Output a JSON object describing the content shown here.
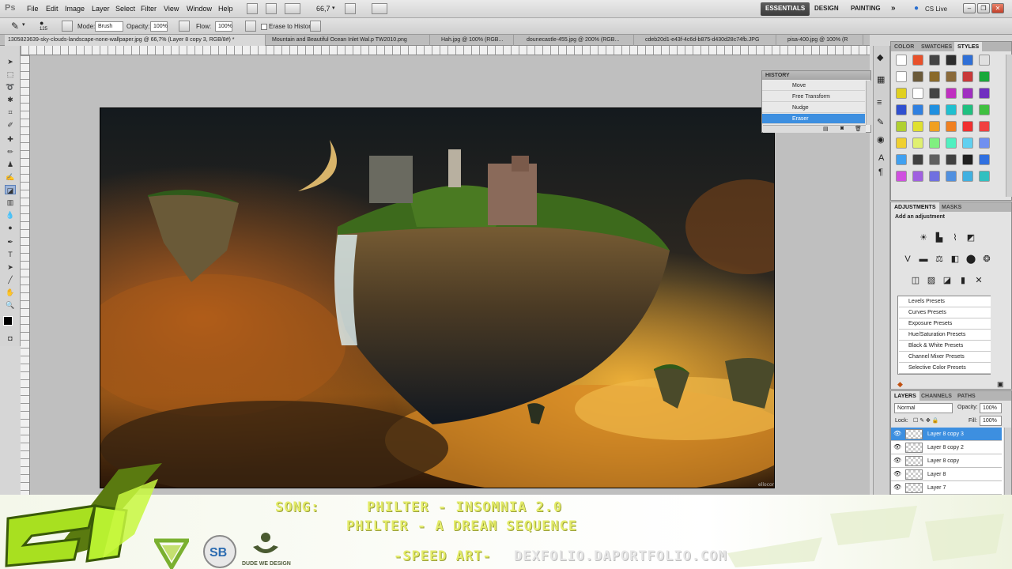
{
  "app": {
    "logo": "Ps"
  },
  "menubar": {
    "items": [
      "File",
      "Edit",
      "Image",
      "Layer",
      "Select",
      "Filter",
      "View",
      "Window",
      "Help"
    ],
    "zoom": "66,7",
    "workspaces": [
      "ESSENTIALS",
      "DESIGN",
      "PAINTING"
    ],
    "cs_live": "CS Live"
  },
  "options": {
    "brush_size": "125",
    "mode_label": "Mode:",
    "mode_value": "Brush",
    "opacity_label": "Opacity:",
    "opacity_value": "100%",
    "flow_label": "Flow:",
    "flow_value": "100%",
    "erase_history": "Erase to History"
  },
  "doc_tabs": [
    "1305823639-sky-clouds-landscape-none-wallpaper.jpg @ 66,7% (Layer 8 copy 3, RGB/8#) *",
    "Mountain and Beautiful Ocean Inlet Wal.p TW2010.png",
    "Hah.jpg @ 100% (RGB...",
    "dounecastle-455.jpg @ 200% (RGB...",
    "cdeb20d1-e43f-4c6d-b875-d430d28c74fb.JPG",
    "pisa-400.jpg @ 100% (R"
  ],
  "history": {
    "title": "HISTORY",
    "items": [
      "Move",
      "Free Transform",
      "Nudge",
      "Eraser"
    ],
    "active_index": 3
  },
  "color_panel": {
    "tabs": [
      "COLOR",
      "SWATCHES",
      "STYLES"
    ],
    "active": "STYLES",
    "swatches": [
      "#ffffff",
      "#e8502a",
      "#444444",
      "#2d2d2d",
      "#2f6fd6",
      "#e0e0e0",
      "#ffffff",
      "#6b5a3a",
      "#8a6a2a",
      "#8a6a3a",
      "#c83a3a",
      "#1aa83a",
      "#e0d020",
      "#ffffff",
      "#454545",
      "#c030c0",
      "#a030c0",
      "#7030c0",
      "#3050d0",
      "#3080e0",
      "#2090e0",
      "#20c0d0",
      "#20c080",
      "#40c040",
      "#b0d030",
      "#e0e030",
      "#f0a020",
      "#f08020",
      "#f03030",
      "#f04040",
      "#f0d030",
      "#e0f070",
      "#80f080",
      "#50f0c0",
      "#60d0f0",
      "#7090f0",
      "#40a0f0",
      "#404040",
      "#606060",
      "#404040",
      "#202020",
      "#3070e0",
      "#d050e0",
      "#a060e0",
      "#7070e0",
      "#5090e0",
      "#40b0e0",
      "#30c0c0"
    ]
  },
  "adjustments": {
    "tabs": [
      "ADJUSTMENTS",
      "MASKS"
    ],
    "subtitle": "Add an adjustment",
    "presets": [
      "Levels Presets",
      "Curves Presets",
      "Exposure Presets",
      "Hue/Saturation Presets",
      "Black & White Presets",
      "Channel Mixer Presets",
      "Selective Color Presets"
    ]
  },
  "layers": {
    "tabs": [
      "LAYERS",
      "CHANNELS",
      "PATHS"
    ],
    "blend_mode": "Normal",
    "opacity_label": "Opacity:",
    "opacity_value": "100%",
    "lock_label": "Lock:",
    "fill_label": "Fill:",
    "fill_value": "100%",
    "items": [
      "Layer 8 copy 3",
      "Layer 8 copy 2",
      "Layer 8 copy",
      "Layer 8",
      "Layer 7"
    ],
    "active_index": 0
  },
  "banner": {
    "song_label": "SONG:",
    "track1": "PHILTER - INSOMNIA 2.0",
    "track2": "PHILTER - A DREAM SEQUENCE",
    "speed_art": "-SPEED ART-",
    "url": "DEXFOLIO.DAPORTFOLIO.COM",
    "dude_logo": "DUDE WE DESIGN"
  }
}
